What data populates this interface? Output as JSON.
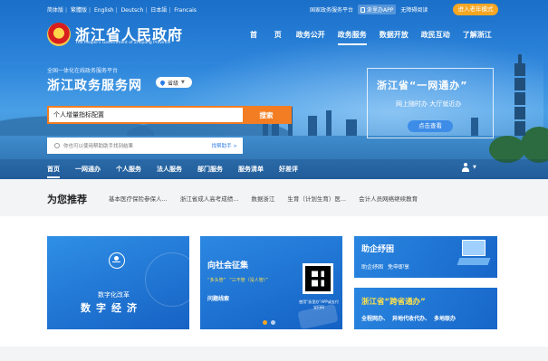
{
  "lang_links": [
    "简体版",
    "繁體版",
    "English",
    "Deutsch",
    "日本語",
    "Francais"
  ],
  "top_right": {
    "platform": "国家政务服务平台",
    "app": "浙里办APP",
    "accessible": "无障碍阅读",
    "elder": "进入老年模式"
  },
  "site": {
    "title": "浙江省人民政府",
    "subtitle": "The People's Government of Zhejiang Province"
  },
  "main_nav": [
    "首    页",
    "政务公开",
    "政务服务",
    "数据开放",
    "政民互动",
    "了解浙江"
  ],
  "main_nav_active": "政务服务",
  "platform": {
    "small": "全国一体化在线政务服务平台",
    "title": "浙江政务服务网",
    "level": "省级"
  },
  "search": {
    "value": "个人增量指标配置",
    "button": "搜索",
    "hint": "你也可以使用帮助助手找到结果",
    "help": "找帮助手 >"
  },
  "promo": {
    "title": "浙江省“一网通办”",
    "subtitle": "网上随时办 大厅就近办",
    "button": "点击查看"
  },
  "sub_nav": [
    "首页",
    "一网通办",
    "个人服务",
    "法人服务",
    "部门服务",
    "服务清单",
    "好差评"
  ],
  "recommend": {
    "title": "为您推荐",
    "items": [
      "基本医疗保险参保人...",
      "浙江省成人高考成绩...",
      "数据浙江",
      "生育（计划生育）医...",
      "会计人员网络继续教育"
    ]
  },
  "cards": {
    "digital": {
      "small": "数字化改革",
      "big": "数字经济"
    },
    "social": {
      "title": "向社会征集",
      "tags": [
        "“多头管”",
        "“三不管（没人管）”"
      ],
      "button": "问题线索",
      "qr_caption": "使用“浙里办”APP或支付宝扫码"
    },
    "relief": {
      "title": "助企纾困",
      "items": [
        "助企纾困",
        "免申即享"
      ]
    },
    "cross": {
      "title": "浙江省“跨省通办”",
      "items": [
        "全程网办、",
        "异地代收代办、",
        "多地联办"
      ]
    }
  },
  "colors": {
    "accent": "#f27d22",
    "brand_blue": "#1f74d6",
    "yellow": "#ffe24a"
  }
}
